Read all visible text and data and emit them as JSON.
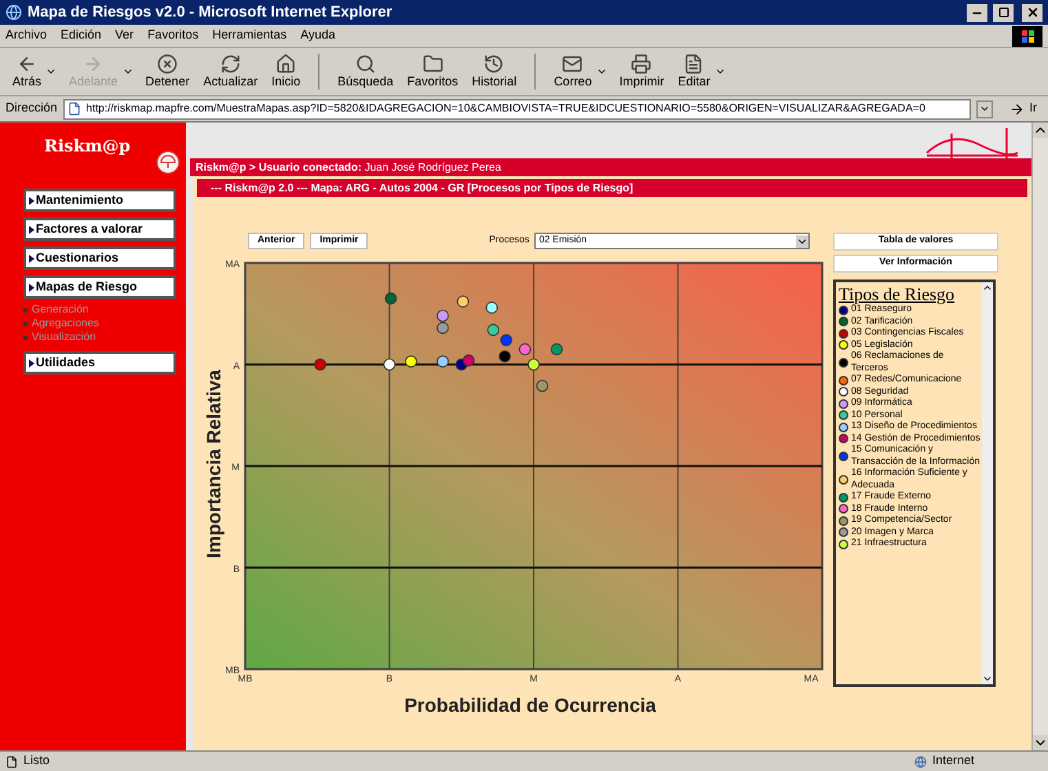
{
  "window": {
    "title": "Mapa de Riesgos v2.0 - Microsoft Internet Explorer"
  },
  "menu": [
    "Archivo",
    "Edición",
    "Ver",
    "Favoritos",
    "Herramientas",
    "Ayuda"
  ],
  "toolbar": [
    {
      "label": "Atrás",
      "kind": "back",
      "disabled": false,
      "dropdown": true
    },
    {
      "label": "Adelante",
      "kind": "forward",
      "disabled": true,
      "dropdown": true
    },
    {
      "label": "Detener",
      "kind": "stop",
      "disabled": false,
      "dropdown": false
    },
    {
      "label": "Actualizar",
      "kind": "refresh",
      "disabled": false,
      "dropdown": false
    },
    {
      "label": "Inicio",
      "kind": "home",
      "disabled": false,
      "dropdown": false
    },
    {
      "label": "Búsqueda",
      "kind": "search",
      "disabled": false,
      "dropdown": false,
      "separator": true
    },
    {
      "label": "Favoritos",
      "kind": "favorites",
      "disabled": false,
      "dropdown": false
    },
    {
      "label": "Historial",
      "kind": "history",
      "disabled": false,
      "dropdown": false
    },
    {
      "label": "Correo",
      "kind": "mail",
      "disabled": false,
      "dropdown": true,
      "separator": true
    },
    {
      "label": "Imprimir",
      "kind": "print",
      "disabled": false,
      "dropdown": false
    },
    {
      "label": "Editar",
      "kind": "edit",
      "disabled": false,
      "dropdown": true
    }
  ],
  "address": {
    "label": "Dirección",
    "value": "http://riskmap.mapfre.com/MuestraMapas.asp?ID=5820&IDAGREGACION=10&CAMBIOVISTA=TRUE&IDCUESTIONARIO=5580&ORIGEN=VISUALIZAR&AGREGADA=0",
    "go": "Ir"
  },
  "sidebar": {
    "logo": "Riskm@p",
    "items": [
      {
        "label": "Mantenimiento"
      },
      {
        "label": "Factores a valorar"
      },
      {
        "label": "Cuestionarios"
      },
      {
        "label": "Mapas de Riesgo",
        "children": [
          {
            "label": "Generación",
            "disabled": true
          },
          {
            "label": "Agregaciones",
            "disabled": true
          },
          {
            "label": "Visualización",
            "disabled": true
          }
        ]
      },
      {
        "label": "Utilidades"
      }
    ]
  },
  "header": {
    "user_bar": "**Riskm@p > Usuario conectado:** Juan José Rodríguez Perea",
    "map_bar": "--- Riskm@p 2.0 --- Mapa: ARG - Autos 2004 - GR [Procesos por Tipos de Riesgo]"
  },
  "actions": [
    "Anterior",
    "Imprimir"
  ],
  "process": {
    "label": "Procesos",
    "value": "02 Emisión"
  },
  "side_buttons": [
    "Tabla de valores",
    "Ver Información"
  ],
  "legend": {
    "title": "Tipos de Riesgo",
    "items": [
      {
        "label": "01 Reaseguro",
        "color": "#00008b"
      },
      {
        "label": "02 Tarificación",
        "color": "#006633"
      },
      {
        "label": "03 Contingencias Fiscales",
        "color": "#cc0000"
      },
      {
        "label": "05 Legislación",
        "color": "#ffff00"
      },
      {
        "label": "06 Reclamaciones de Terceros",
        "color": "#000000"
      },
      {
        "label": "07 Redes/Comunicacione",
        "color": "#ff6600"
      },
      {
        "label": "08 Seguridad",
        "color": "#ffffff"
      },
      {
        "label": "09 Informática",
        "color": "#cc99ff"
      },
      {
        "label": "10 Personal",
        "color": "#33cc99"
      },
      {
        "label": "13 Diseño de Procedimientos",
        "color": "#99ccff"
      },
      {
        "label": "14 Gestión de Procedimientos",
        "color": "#cc0066"
      },
      {
        "label": "15 Comunicación y Transacción de la Información",
        "color": "#0033ff"
      },
      {
        "label": "16 Información Suficiente y Adecuada",
        "color": "#ffcc66"
      },
      {
        "label": "17 Fraude Externo",
        "color": "#009966"
      },
      {
        "label": "18 Fraude Interno",
        "color": "#ff66cc"
      },
      {
        "label": "19 Competencia/Sector",
        "color": "#999966"
      },
      {
        "label": "20 Imagen y Marca",
        "color": "#999999"
      },
      {
        "label": "21 Infraestructura",
        "color": "#ccff33"
      }
    ]
  },
  "risk_map": {
    "xlabel": "Probabilidad de Ocurrencia",
    "ylabel": "Importancia Relativa",
    "x_levels": [
      "MB",
      "B",
      "M",
      "A",
      "MA"
    ],
    "y_levels": [
      "MA",
      "A",
      "M",
      "B",
      "MB"
    ]
  },
  "status": {
    "text": "Listo",
    "zone": "Internet"
  }
}
